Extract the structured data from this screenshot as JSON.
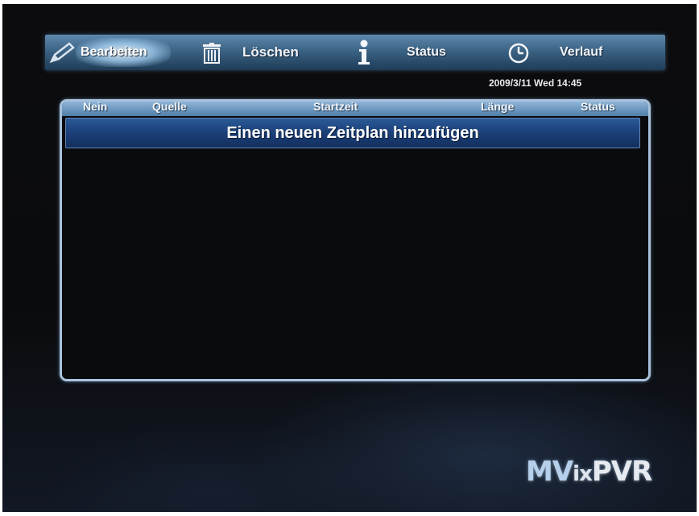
{
  "menu": {
    "edit_label": "Bearbeiten",
    "delete_label": "Löschen",
    "status_label": "Status",
    "history_label": "Verlauf"
  },
  "datetime": "2009/3/11 Wed 14:45",
  "table": {
    "columns": [
      "Nein",
      "Quelle",
      "Startzeit",
      "Länge",
      "Status"
    ],
    "add_row_label": "Einen neuen Zeitplan hinzufügen"
  },
  "logo": {
    "prefix": "MV",
    "middle": "ix",
    "suffix": "PVR"
  },
  "icons": {
    "edit": "pencil-icon",
    "delete": "trash-icon",
    "status": "info-icon",
    "history": "clock-icon"
  },
  "colors": {
    "menu_bar": "#3b6384",
    "panel_border": "#a9c2dc",
    "selected_row": "#1b3f78",
    "background": "#0a0b0d"
  }
}
